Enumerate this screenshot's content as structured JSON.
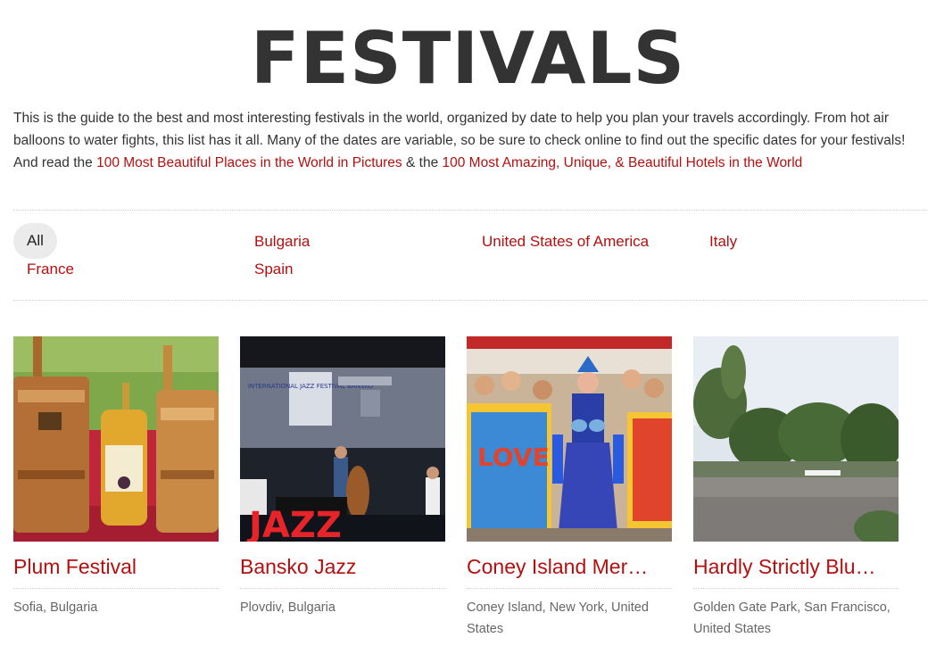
{
  "page": {
    "title": "FESTIVALS",
    "intro": {
      "text": "This is the guide to the best and most interesting festivals in the world, organized by date to help you plan your travels accordingly. From hot air balloons to water fights, this list has it all. Many of the dates are variable, so be sure to check online to find out the specific dates for your festivals! And read the ",
      "link1": "100 Most Beautiful Places in the World in Pictures",
      "middle": " & the ",
      "link2": "100 Most Amazing, Unique, & Beautiful Hotels in the World"
    }
  },
  "filters": {
    "all": "All",
    "bulgaria": "Bulgaria",
    "usa": "United States of America",
    "italy": "Italy",
    "france": "France",
    "spain": "Spain"
  },
  "cards": [
    {
      "title": "Plum Festival",
      "location": "Sofia, Bulgaria",
      "image": "plum-festival-photo"
    },
    {
      "title": "Bansko Jazz",
      "location": "Plovdiv, Bulgaria",
      "image": "bansko-jazz-photo",
      "sign": "INTERNATIONAL JAZZ FESTIVAL BANSKO",
      "banner": "JAZZ"
    },
    {
      "title": "Coney Island Mer…",
      "location": "Coney Island, New York, United States",
      "image": "coney-island-photo",
      "banner": "LOVE"
    },
    {
      "title": "Hardly Strictly Blu…",
      "location": "Golden Gate Park, San Francisco, United States",
      "image": "hardly-strictly-photo"
    }
  ],
  "colors": {
    "accent": "#b50f0f",
    "text": "#333333",
    "muted": "#666666"
  }
}
